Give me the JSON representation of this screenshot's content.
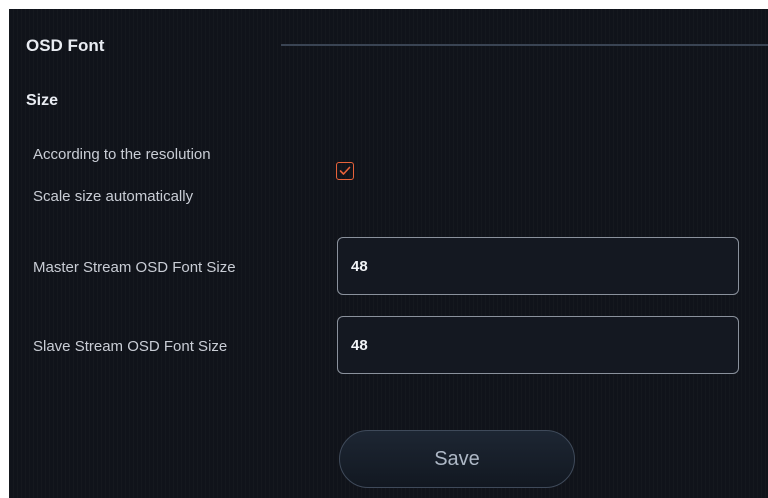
{
  "section": {
    "title": "OSD Font",
    "subtitle": "Size"
  },
  "auto_scale": {
    "label_line1": "According to the resolution",
    "label_line2": "Scale size automatically",
    "checked": true,
    "check_icon": "check-icon",
    "accent_color": "#e8623a"
  },
  "master_stream": {
    "label": "Master Stream OSD Font Size",
    "value": "48"
  },
  "slave_stream": {
    "label": "Slave Stream OSD Font Size",
    "value": "48"
  },
  "actions": {
    "save_label": "Save"
  }
}
